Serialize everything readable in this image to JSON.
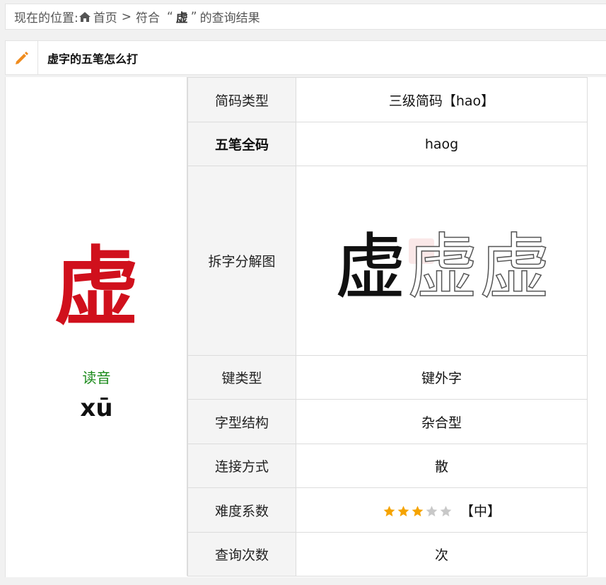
{
  "breadcrumb": {
    "prefix": "现在的位置:",
    "home": "首页",
    "separator": ">",
    "query_before": "符合",
    "quote_open": "“",
    "keyword": "虚",
    "quote_close": "”",
    "query_after": "的查询结果"
  },
  "panel": {
    "icon": "pencil-icon",
    "title": "虚字的五笔怎么打"
  },
  "character": {
    "glyph": "虚",
    "reading_label": "读音",
    "pinyin": "xū"
  },
  "table": {
    "rows": [
      {
        "key": "简码类型",
        "value": "三级简码【hao】"
      },
      {
        "key": "五笔全码",
        "value": "haog"
      },
      {
        "key": "拆字分解图",
        "value_glyphs": [
          "虚",
          "虚",
          "虚"
        ]
      },
      {
        "key": "键类型",
        "value": "键外字"
      },
      {
        "key": "字型结构",
        "value": "杂合型"
      },
      {
        "key": "连接方式",
        "value": "散"
      },
      {
        "key": "难度系数",
        "stars_filled": 3,
        "stars_total": 5,
        "value": "【中】"
      },
      {
        "key": "查询次数",
        "value": "次"
      }
    ]
  },
  "colors": {
    "accent_char": "#d0101c",
    "reading_label": "#1a8a1a",
    "star_filled": "#f5a300",
    "star_empty": "#c8c8c8",
    "pencil": "#f08c1e"
  }
}
